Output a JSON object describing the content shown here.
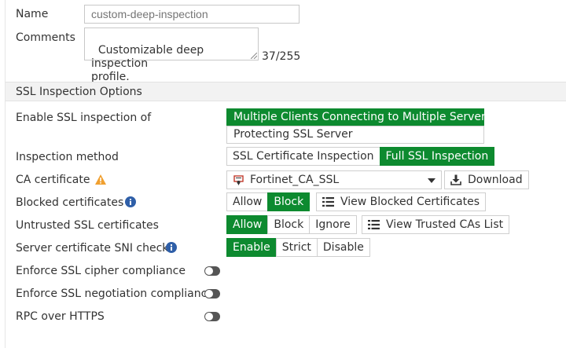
{
  "profile": {
    "name_label": "Name",
    "name_placeholder": "custom-deep-inspection",
    "comments_label": "Comments",
    "comments_value": "Customizable deep inspection\nprofile.",
    "comments_counter": "37/255"
  },
  "ssl": {
    "section_title": "SSL Inspection Options",
    "enable_label": "Enable SSL inspection of",
    "enable_options": [
      "Multiple Clients Connecting to Multiple Servers",
      "Protecting SSL Server"
    ],
    "enable_selected": "Multiple Clients Connecting to Multiple Servers",
    "method_label": "Inspection method",
    "method_options": [
      "SSL Certificate Inspection",
      "Full SSL Inspection"
    ],
    "method_selected": "Full SSL Inspection",
    "ca_label": "CA certificate",
    "ca_value": "Fortinet_CA_SSL",
    "download_label": "Download",
    "blocked_label": "Blocked certificates",
    "blocked_options": [
      "Allow",
      "Block"
    ],
    "blocked_selected": "Block",
    "view_blocked_label": "View Blocked Certificates",
    "untrusted_label": "Untrusted SSL certificates",
    "untrusted_options": [
      "Allow",
      "Block",
      "Ignore"
    ],
    "untrusted_selected": "Allow",
    "view_trusted_label": "View Trusted CAs List",
    "sni_label": "Server certificate SNI check",
    "sni_options": [
      "Enable",
      "Strict",
      "Disable"
    ],
    "sni_selected": "Enable",
    "cipher_label": "Enforce SSL cipher compliance",
    "negotiation_label": "Enforce SSL negotiation compliance",
    "rpc_label": "RPC over HTTPS",
    "cipher_on": false,
    "negotiation_on": false,
    "rpc_on": false
  },
  "icons": {
    "warning": "warning-triangle-icon",
    "info": "info-circle-icon",
    "certificate": "certificate-icon",
    "download": "download-icon",
    "list": "list-icon"
  },
  "colors": {
    "accent_green": "#0d8a2f",
    "warning_orange": "#f0a030",
    "info_blue": "#2f5fa8"
  }
}
